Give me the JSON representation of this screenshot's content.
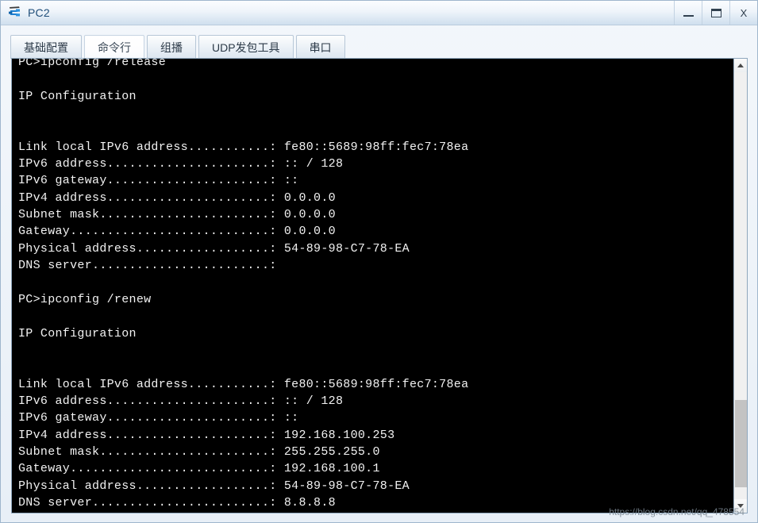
{
  "window": {
    "title": "PC2",
    "icon": "network-device-icon",
    "controls": {
      "minimize_label": "—",
      "maximize_label": "❐",
      "close_label": "X"
    }
  },
  "tabs": [
    {
      "label": "基础配置",
      "name": "tab-basic-config",
      "active": false
    },
    {
      "label": "命令行",
      "name": "tab-command-line",
      "active": true
    },
    {
      "label": "组播",
      "name": "tab-multicast",
      "active": false
    },
    {
      "label": "UDP发包工具",
      "name": "tab-udp-tool",
      "active": false
    },
    {
      "label": "串口",
      "name": "tab-serial-port",
      "active": false
    }
  ],
  "terminal": {
    "background_color": "#000000",
    "text_color": "#f2f2f2",
    "lines": [
      "PC>ipconfig /release",
      "",
      "IP Configuration",
      "",
      "",
      "Link local IPv6 address...........: fe80::5689:98ff:fec7:78ea",
      "IPv6 address......................: :: / 128",
      "IPv6 gateway......................: ::",
      "IPv4 address......................: 0.0.0.0",
      "Subnet mask.......................: 0.0.0.0",
      "Gateway...........................: 0.0.0.0",
      "Physical address..................: 54-89-98-C7-78-EA",
      "DNS server........................:",
      "",
      "PC>ipconfig /renew",
      "",
      "IP Configuration",
      "",
      "",
      "Link local IPv6 address...........: fe80::5689:98ff:fec7:78ea",
      "IPv6 address......................: :: / 128",
      "IPv6 gateway......................: ::",
      "IPv4 address......................: 192.168.100.253",
      "Subnet mask.......................: 255.255.255.0",
      "Gateway...........................: 192.168.100.1",
      "Physical address..................: 54-89-98-C7-78-EA",
      "DNS server........................: 8.8.8.8"
    ]
  },
  "scrollbar": {
    "up_arrow": "chevron-up-icon",
    "down_arrow": "chevron-down-icon"
  },
  "watermark": {
    "text": "https://blog.csdn.net/qq_478554"
  }
}
